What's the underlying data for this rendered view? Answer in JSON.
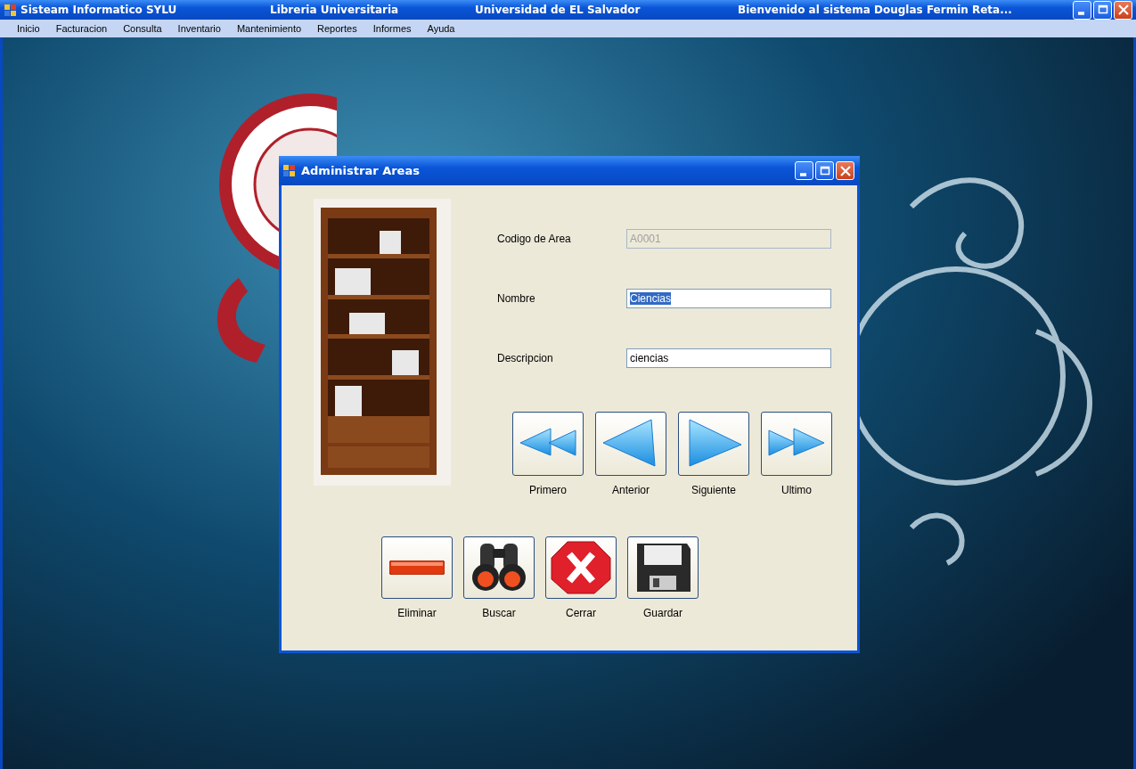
{
  "window": {
    "title_segments": [
      "Sisteam Informatico SYLU",
      "Libreria Universitaria",
      "Universidad de EL Salvador",
      "Bienvenido al sistema Douglas Fermin Reta..."
    ]
  },
  "menu": [
    "Inicio",
    "Facturacion",
    "Consulta",
    "Inventario",
    "Mantenimiento",
    "Reportes",
    "Informes",
    "Ayuda"
  ],
  "dialog": {
    "title": "Administrar Areas",
    "fields": [
      {
        "label": "Codigo de Area",
        "value": "A0001",
        "disabled": true,
        "selected": false
      },
      {
        "label": "Nombre",
        "value": "Ciencias",
        "disabled": false,
        "selected": true
      },
      {
        "label": "Descripcion",
        "value": "ciencias",
        "disabled": false,
        "selected": false
      }
    ],
    "nav_buttons": [
      {
        "kind": "first",
        "label": "Primero"
      },
      {
        "kind": "previous",
        "label": "Anterior"
      },
      {
        "kind": "next",
        "label": "Siguiente"
      },
      {
        "kind": "last",
        "label": "Ultimo"
      }
    ],
    "action_buttons": [
      {
        "kind": "remove",
        "label": "Eliminar"
      },
      {
        "kind": "search",
        "label": "Buscar"
      },
      {
        "kind": "close",
        "label": "Cerrar"
      },
      {
        "kind": "save",
        "label": "Guardar"
      }
    ]
  }
}
